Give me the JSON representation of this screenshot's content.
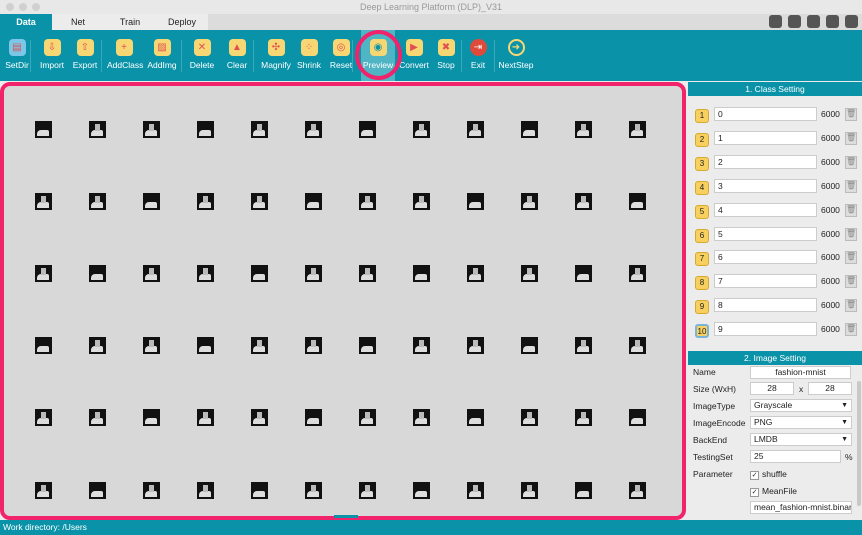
{
  "window": {
    "title": "Deep Learning Platform (DLP)_V31"
  },
  "tabs": [
    {
      "label": "Data"
    },
    {
      "label": "Net"
    },
    {
      "label": "Train"
    },
    {
      "label": "Deploy"
    }
  ],
  "toolbar": [
    {
      "label": "SetDir",
      "icon": "folder-icon"
    },
    {
      "label": "Import",
      "icon": "import-icon"
    },
    {
      "label": "Export",
      "icon": "export-icon"
    },
    {
      "label": "AddClass",
      "icon": "add-folder-icon"
    },
    {
      "label": "AddImg",
      "icon": "add-image-icon"
    },
    {
      "label": "Delete",
      "icon": "delete-image-icon"
    },
    {
      "label": "Clear",
      "icon": "clear-icon"
    },
    {
      "label": "Magnify",
      "icon": "magnify-icon"
    },
    {
      "label": "Shrink",
      "icon": "shrink-icon"
    },
    {
      "label": "Reset",
      "icon": "reset-icon"
    },
    {
      "label": "Preview",
      "icon": "eye-icon"
    },
    {
      "label": "Convert",
      "icon": "play-icon"
    },
    {
      "label": "Stop",
      "icon": "stop-icon"
    },
    {
      "label": "Exit",
      "icon": "exit-icon"
    },
    {
      "label": "NextStep",
      "icon": "arrow-right-icon"
    }
  ],
  "toolbar_selected": "Preview",
  "accent_color": "#0a93a8",
  "highlight_color": "#f0236b",
  "class_setting": {
    "title": "1. Class Setting",
    "classes": [
      {
        "index": "1",
        "name": "0",
        "count": "6000"
      },
      {
        "index": "2",
        "name": "1",
        "count": "6000"
      },
      {
        "index": "3",
        "name": "2",
        "count": "6000"
      },
      {
        "index": "4",
        "name": "3",
        "count": "6000"
      },
      {
        "index": "5",
        "name": "4",
        "count": "6000"
      },
      {
        "index": "6",
        "name": "5",
        "count": "6000"
      },
      {
        "index": "7",
        "name": "6",
        "count": "6000"
      },
      {
        "index": "8",
        "name": "7",
        "count": "6000"
      },
      {
        "index": "9",
        "name": "8",
        "count": "6000"
      },
      {
        "index": "10",
        "name": "9",
        "count": "6000"
      }
    ]
  },
  "image_setting": {
    "title": "2. Image Setting",
    "name_label": "Name",
    "name": "fashion-mnist",
    "size_label": "Size (WxH)",
    "width": "28",
    "x": "x",
    "height": "28",
    "type_label": "ImageType",
    "type": "Grayscale",
    "encode_label": "ImageEncode",
    "encode": "PNG",
    "backend_label": "BackEnd",
    "backend": "LMDB",
    "testing_label": "TestingSet",
    "testing": "25",
    "percent": "%",
    "param_label": "Parameter",
    "shuffle": "shuffle",
    "meanfile": "MeanFile",
    "meanfile_path": "mean_fashion-mnist.binaryp"
  },
  "status": "Work directory: /Users"
}
